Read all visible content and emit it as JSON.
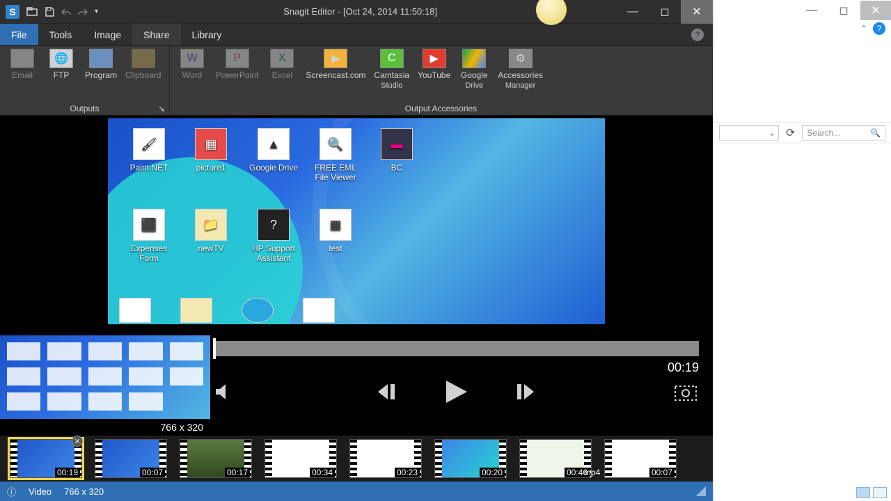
{
  "app": {
    "title": "Snagit Editor - [Oct 24, 2014 11:50:18]"
  },
  "menu": {
    "file": "File",
    "tools": "Tools",
    "image": "Image",
    "share": "Share",
    "library": "Library"
  },
  "ribbon": {
    "outputs_label": "Outputs",
    "accessories_label": "Output Accessories",
    "email": "Email",
    "ftp": "FTP",
    "program": "Program",
    "clipboard": "Clipboard",
    "word": "Word",
    "powerpoint": "PowerPoint",
    "excel": "Excel",
    "screencast": "Screencast.com",
    "camtasia_l1": "Camtasia",
    "camtasia_l2": "Studio",
    "youtube": "YouTube",
    "gdrive_l1": "Google",
    "gdrive_l2": "Drive",
    "acc_l1": "Accessories",
    "acc_l2": "Manager"
  },
  "desktop_icons": {
    "paintnet": "Paint.NET",
    "picture1": "picture1",
    "googledrive": "Google Drive",
    "eml_l1": "FREE EML",
    "eml_l2": "File Viewer",
    "bc": "BC",
    "expenses_l1": "Expenses",
    "expenses_l2": "Form",
    "newtv": "newTV",
    "hp_l1": "HP Support",
    "hp_l2": "Assistant",
    "test": "test"
  },
  "player": {
    "time": "00:19",
    "dim": "766 x 320"
  },
  "tray": [
    {
      "dur": "00:19"
    },
    {
      "dur": "00:07"
    },
    {
      "dur": "00:17"
    },
    {
      "dur": "00:34"
    },
    {
      "dur": "00:23"
    },
    {
      "dur": "00:20"
    },
    {
      "dur": "00:46"
    },
    {
      "dur": "00:07",
      "prefix": "mp4"
    }
  ],
  "status": {
    "type": "Video",
    "dim": "766 x 320"
  },
  "bgwin": {
    "search_placeholder": "Search..."
  }
}
